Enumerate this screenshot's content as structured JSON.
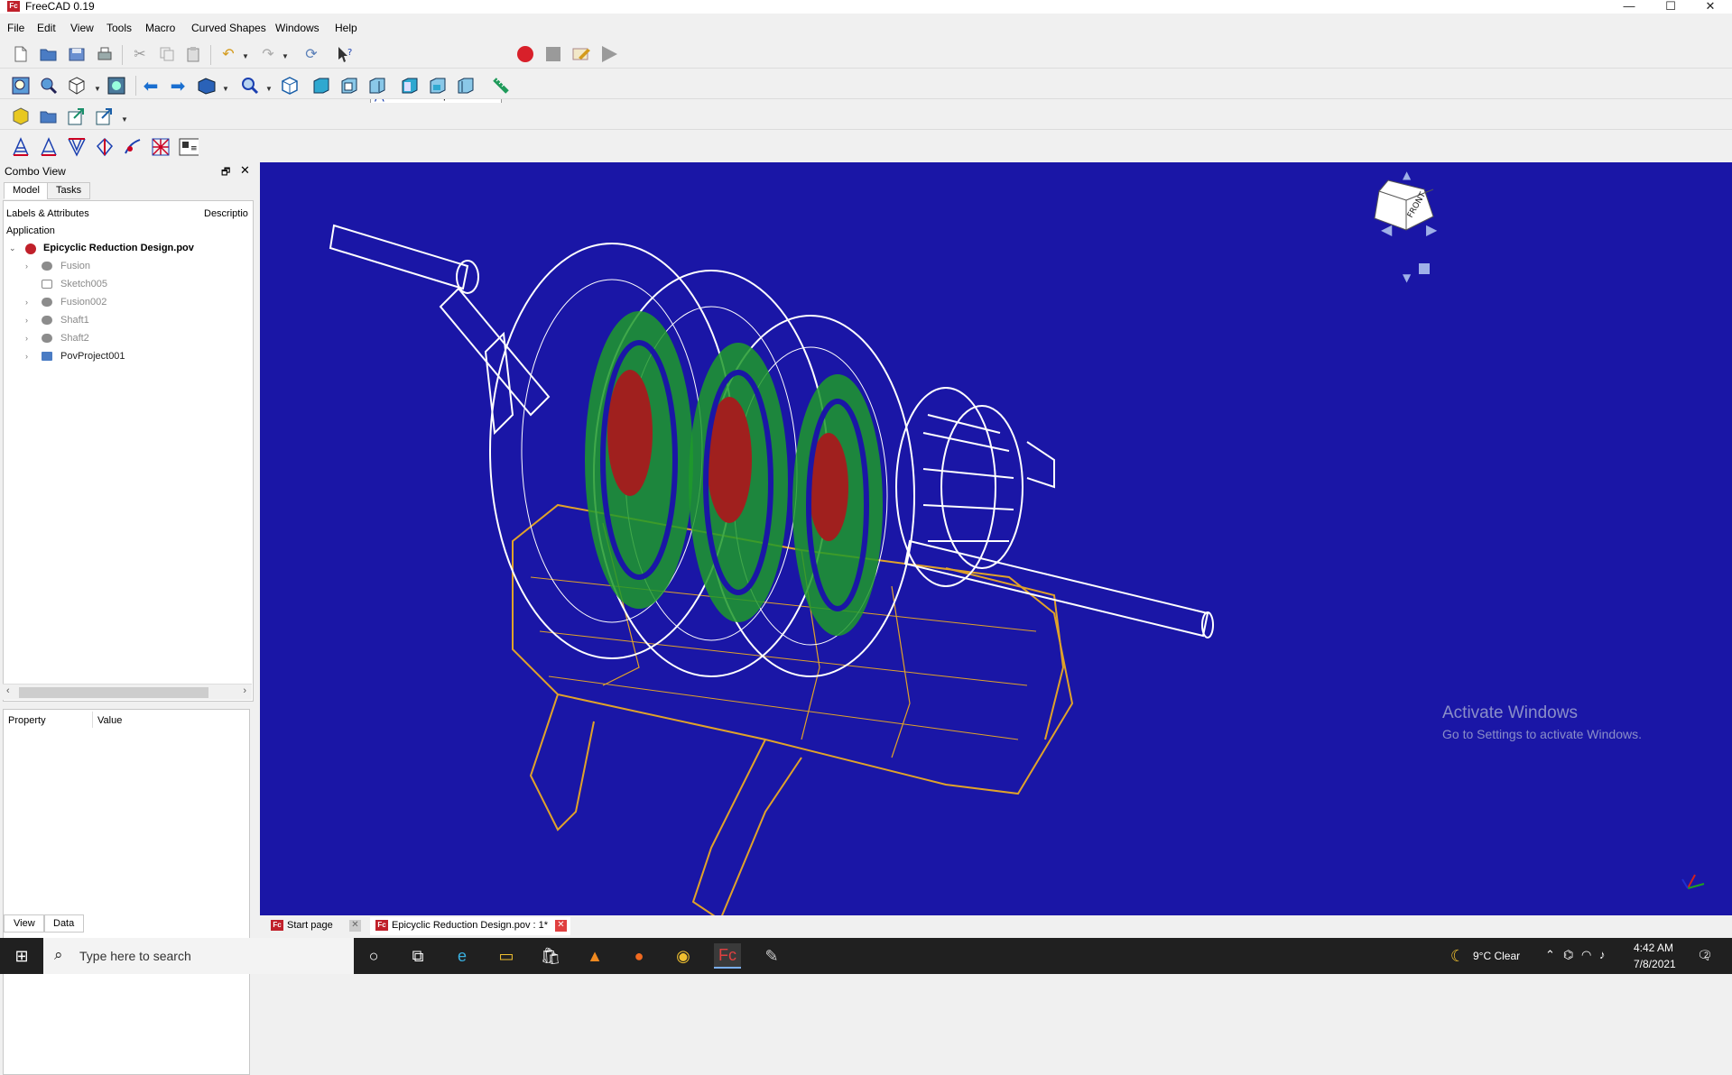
{
  "window": {
    "title": "FreeCAD 0.19",
    "app_icon_text": "Fc",
    "minimize_glyph": "—",
    "maximize_glyph": "☐",
    "close_glyph": "✕"
  },
  "menu": [
    "File",
    "Edit",
    "View",
    "Tools",
    "Macro",
    "Curved Shapes",
    "Windows",
    "Help"
  ],
  "workbench_select": {
    "value": "Curved Shapes",
    "icon": "curved-shapes-icon"
  },
  "combo_view": {
    "title": "Combo View",
    "tabs": [
      "Model",
      "Tasks"
    ],
    "tree_headers": [
      "Labels & Attributes",
      "Descriptio"
    ],
    "section_label": "Application",
    "document": "Epicyclic Reduction Design.pov",
    "items": [
      "Fusion",
      "Sketch005",
      "Fusion002",
      "Shaft1",
      "Shaft2",
      "PovProject001"
    ],
    "property_headers": [
      "Property",
      "Value"
    ],
    "bottom_tabs": [
      "View",
      "Data"
    ]
  },
  "view3d": {
    "background": "#1a16a6",
    "wire_white": "#ffffff",
    "wire_gold": "#e0a22a",
    "gear_green": "#1f9a2a",
    "gear_red": "#a0201e",
    "navcube_face": "FRONT",
    "watermark_title": "Activate Windows",
    "watermark_sub": "Go to Settings to activate Windows."
  },
  "doc_tabs": [
    {
      "label": "Start page",
      "active": false
    },
    {
      "label": "Epicyclic Reduction Design.pov : 1*",
      "active": true
    }
  ],
  "taskbar": {
    "search_placeholder": "Type here to search",
    "weather": "9°C  Clear",
    "time": "4:42 AM",
    "date": "7/8/2021",
    "notifications": "2"
  }
}
